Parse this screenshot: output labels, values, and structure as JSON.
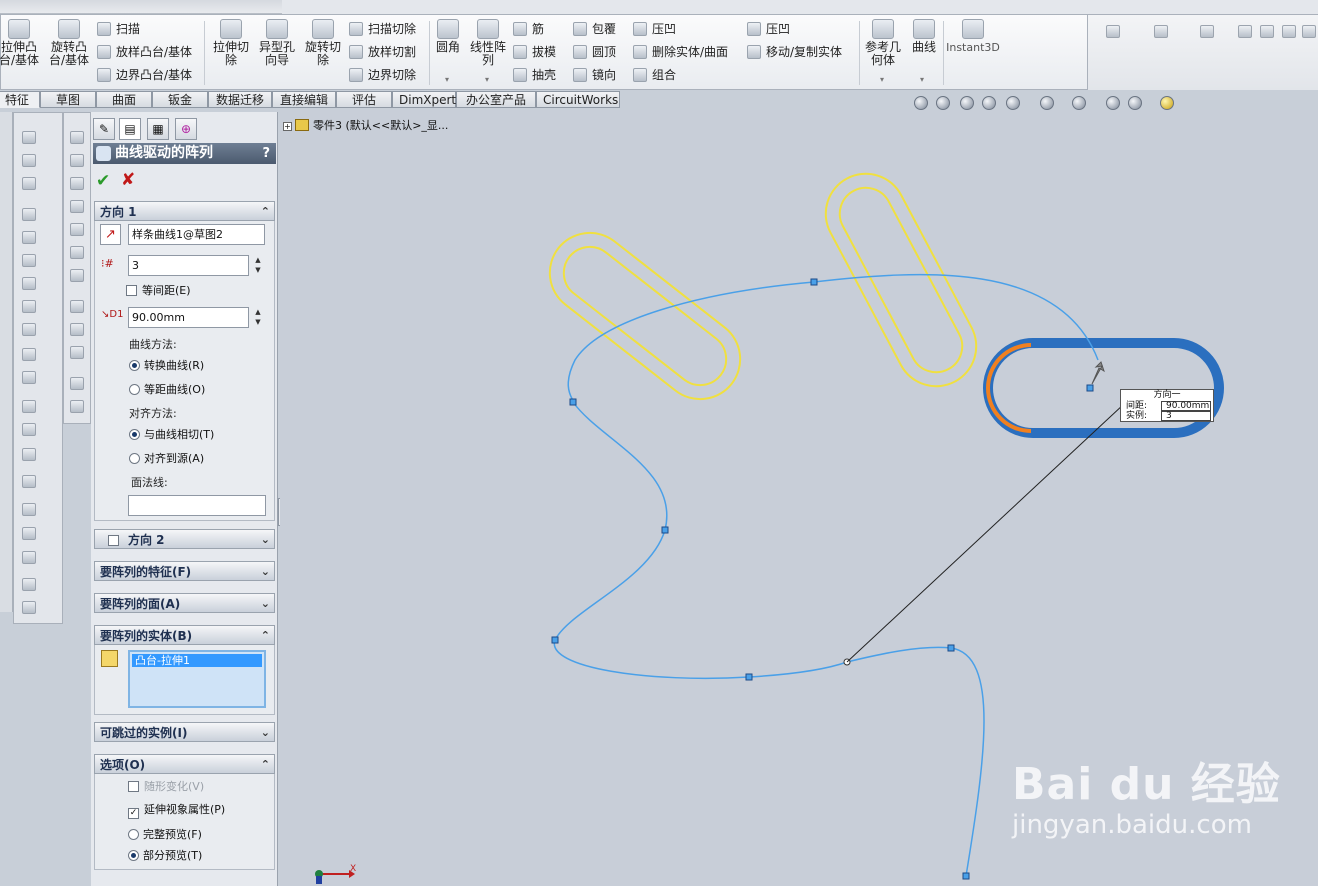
{
  "ribbon": {
    "big_tools": [
      {
        "label": "拉伸凸\n台/基体",
        "name": "extrude-boss-button"
      },
      {
        "label": "旋转凸\n台/基体",
        "name": "revolve-boss-button"
      },
      {
        "label": "拉伸切\n除",
        "name": "extrude-cut-button"
      },
      {
        "label": "异型孔\n向导",
        "name": "hole-wizard-button"
      },
      {
        "label": "旋转切\n除",
        "name": "revolve-cut-button"
      },
      {
        "label": "圆角",
        "name": "fillet-button"
      },
      {
        "label": "线性阵\n列",
        "name": "linear-pattern-button"
      },
      {
        "label": "参考几\n何体",
        "name": "reference-geometry-button"
      },
      {
        "label": "曲线",
        "name": "curves-button"
      },
      {
        "label": "Instant3D",
        "name": "instant3d-button"
      }
    ],
    "small_tools": {
      "sweep": "扫描",
      "loft": "放样凸台/基体",
      "boundary_boss": "边界凸台/基体",
      "swept_cut": "扫描切除",
      "lofted_cut": "放样切割",
      "boundary_cut": "边界切除",
      "rib": "筋",
      "draft": "拔模",
      "shell": "抽壳",
      "wrap": "包覆",
      "dome": "圆顶",
      "mirror": "镜向",
      "indent": "压凹",
      "delete_body": "删除实体/曲面",
      "combine": "组合",
      "indent2": "压凹",
      "move_copy": "移动/复制实体"
    }
  },
  "tabs": [
    "特征",
    "草图",
    "曲面",
    "钣金",
    "数据迁移",
    "直接编辑",
    "评估",
    "DimXpert",
    "办公室产品",
    "CircuitWorks"
  ],
  "property_manager": {
    "title": "曲线驱动的阵列",
    "help": "?",
    "direction1": {
      "header": "方向 1",
      "curve_ref": "样条曲线1@草图2",
      "instances": "3",
      "equal_spacing": "等间距(E)",
      "spacing": "90.00mm",
      "curve_method_label": "曲线方法:",
      "transform_curve": "转换曲线(R)",
      "offset_curve": "等距曲线(O)",
      "align_label": "对齐方法:",
      "tangent": "与曲线相切(T)",
      "align_source": "对齐到源(A)",
      "face_normal_label": "面法线:",
      "face_normal_value": ""
    },
    "direction2": {
      "header": "方向 2"
    },
    "features_header": "要阵列的特征(F)",
    "faces_header": "要阵列的面(A)",
    "bodies": {
      "header": "要阵列的实体(B)",
      "items": [
        "凸台-拉伸1"
      ]
    },
    "skip_header": "可跳过的实例(I)",
    "options": {
      "header": "选项(O)",
      "geometry_pattern": "随形变化(V)",
      "propagate": "延伸视象属性(P)",
      "full_preview": "完整预览(F)",
      "partial_preview": "部分预览(T)"
    }
  },
  "tree": {
    "item": "零件3 (默认<<默认>_显..."
  },
  "callout": {
    "title": "方向一",
    "spacing_label": "间距:",
    "spacing_value": "90.00mm",
    "instances_label": "实例:",
    "instances_value": "3"
  },
  "watermark": {
    "logo": "Bai du 经验",
    "sub": "jingyan.baidu.com"
  },
  "origin": {
    "x_label": "X"
  },
  "colors": {
    "curve": "#4aa0e8",
    "preview": "#f0e040",
    "selected_body": "#2b6fbf",
    "selected_edge": "#f08020",
    "title_bar": "#556479",
    "check": "#2a9a2a",
    "cross": "#c01818"
  }
}
